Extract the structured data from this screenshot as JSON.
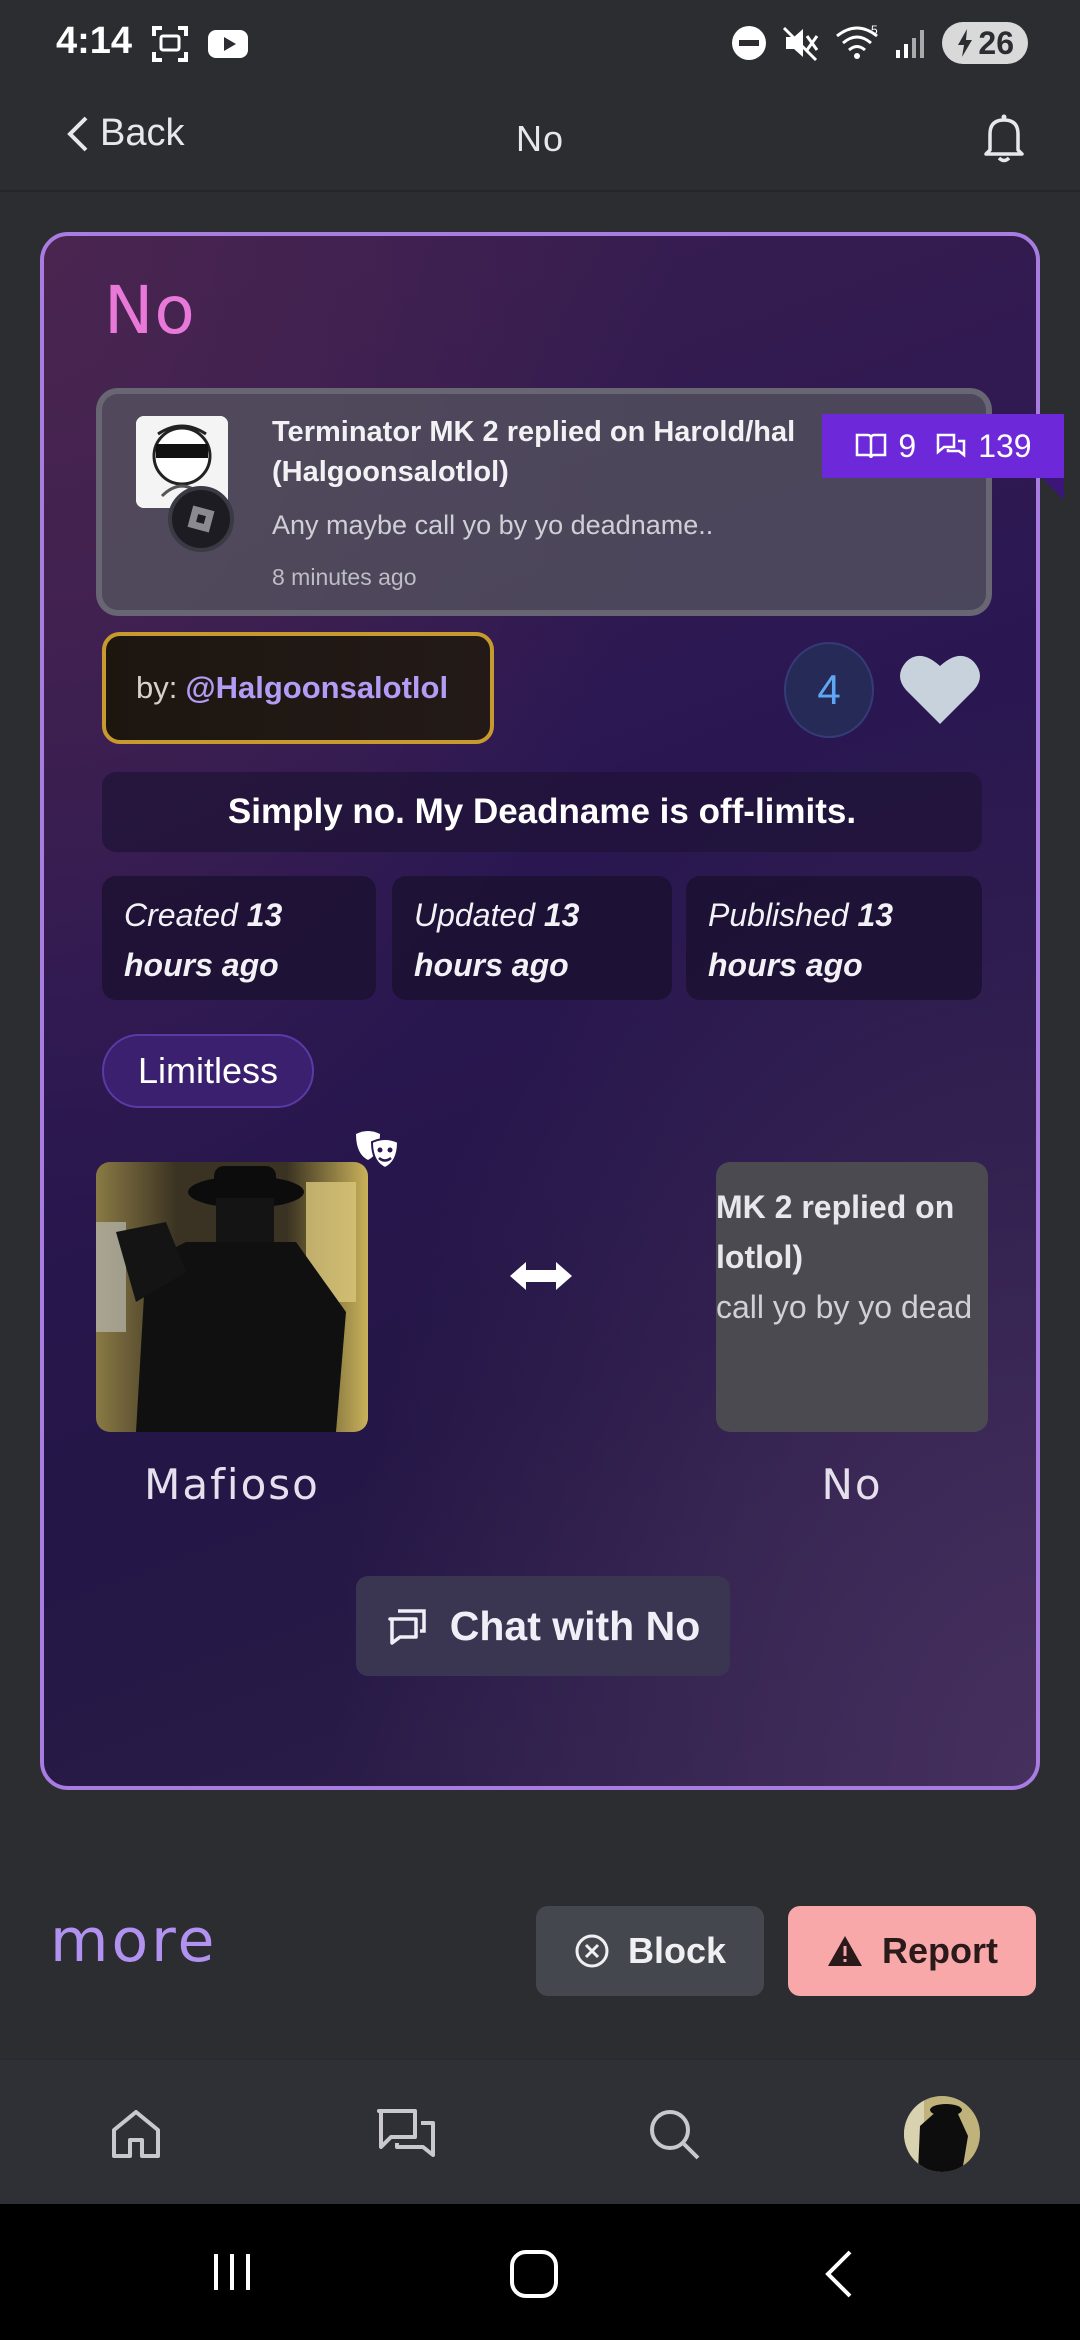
{
  "status_bar": {
    "time": "4:14",
    "battery": "26",
    "icons": [
      "screenshot-icon",
      "youtube-icon",
      "dnd-icon",
      "mute-icon",
      "wifi-icon",
      "signal-icon",
      "battery-icon"
    ],
    "wifi_label": "5"
  },
  "nav": {
    "back_label": "Back",
    "title": "No"
  },
  "card": {
    "title": "No",
    "notification": {
      "title": "Terminator MK 2 replied on Harold/hal (Halgoonsalotlol)",
      "body": "Any maybe call yo by yo deadname..",
      "time": "8 minutes ago"
    },
    "stats": {
      "reads": "9",
      "chats": "139"
    },
    "author_prefix": "by:",
    "author_handle": "@Halgoonsalotlol",
    "like_count": "4",
    "tagline": "Simply no. My Deadname is off-limits.",
    "dates": [
      {
        "label": "Created",
        "value": "13",
        "suffix": "hours ago"
      },
      {
        "label": "Updated",
        "value": "13",
        "suffix": "hours ago"
      },
      {
        "label": "Published",
        "value": "13",
        "suffix": "hours ago"
      }
    ],
    "tag": "Limitless",
    "characters": [
      {
        "name": "Mafioso"
      },
      {
        "name": "No",
        "preview_lines": [
          "MK 2 replied on",
          "lotlol)",
          "call yo by yo dead"
        ]
      }
    ],
    "chat_button": "Chat with No"
  },
  "footer": {
    "more_label": "more",
    "block_label": "Block",
    "report_label": "Report"
  },
  "colors": {
    "accent_purple": "#6d28d9",
    "card_border": "#a87ce0",
    "title_pink": "#e879d8",
    "author_gold": "#c79a2f",
    "report_pink": "#f8a8a8"
  }
}
